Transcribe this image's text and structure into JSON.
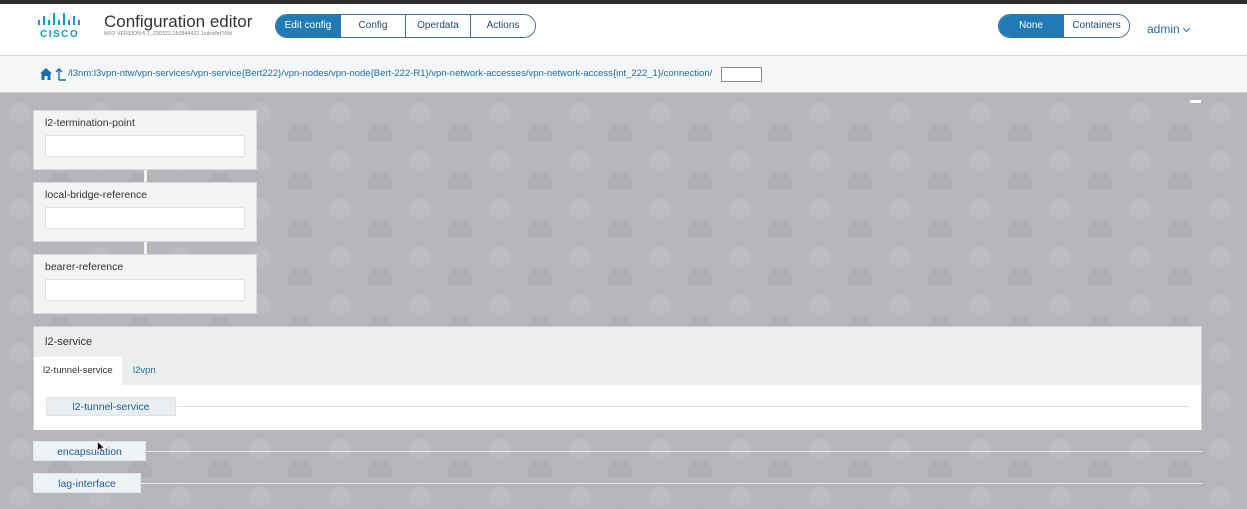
{
  "header": {
    "logo_text": "CISCO",
    "app_title": "Configuration editor",
    "version": "NSO VERSION:6.1_230322.150844422.1cdcefef76fd",
    "mode_tabs": [
      {
        "label": "Edit config",
        "active": true
      },
      {
        "label": "Config",
        "active": false
      },
      {
        "label": "Operdata",
        "active": false
      },
      {
        "label": "Actions",
        "active": false
      }
    ],
    "view_tabs": [
      {
        "label": "None",
        "active": true
      },
      {
        "label": "Containers",
        "active": false
      }
    ],
    "user": "admin"
  },
  "pathbar": {
    "path": "/l3nm:l3vpn-ntw/vpn-services/vpn-service{Bert222}/vpn-nodes/vpn-node{Bert-222-R1}/vpn-network-accesses/vpn-network-access{int_222_1}/connection/",
    "input_value": ""
  },
  "leaves": [
    {
      "label": "l2-termination-point",
      "value": ""
    },
    {
      "label": "local-bridge-reference",
      "value": ""
    },
    {
      "label": "bearer-reference",
      "value": ""
    }
  ],
  "l2_service": {
    "title": "l2-service",
    "tabs": [
      {
        "label": "l2-tunnel-service",
        "active": true
      },
      {
        "label": "l2vpn",
        "active": false
      }
    ],
    "container": "l2-tunnel-service"
  },
  "containers": [
    {
      "label": "encapsulation"
    },
    {
      "label": "lag-interface"
    }
  ],
  "colors": {
    "accent": "#1f7ab8",
    "link": "#1a6fa8",
    "canvas": "#b4b6b9",
    "cisco_blue": "#049fd9"
  }
}
